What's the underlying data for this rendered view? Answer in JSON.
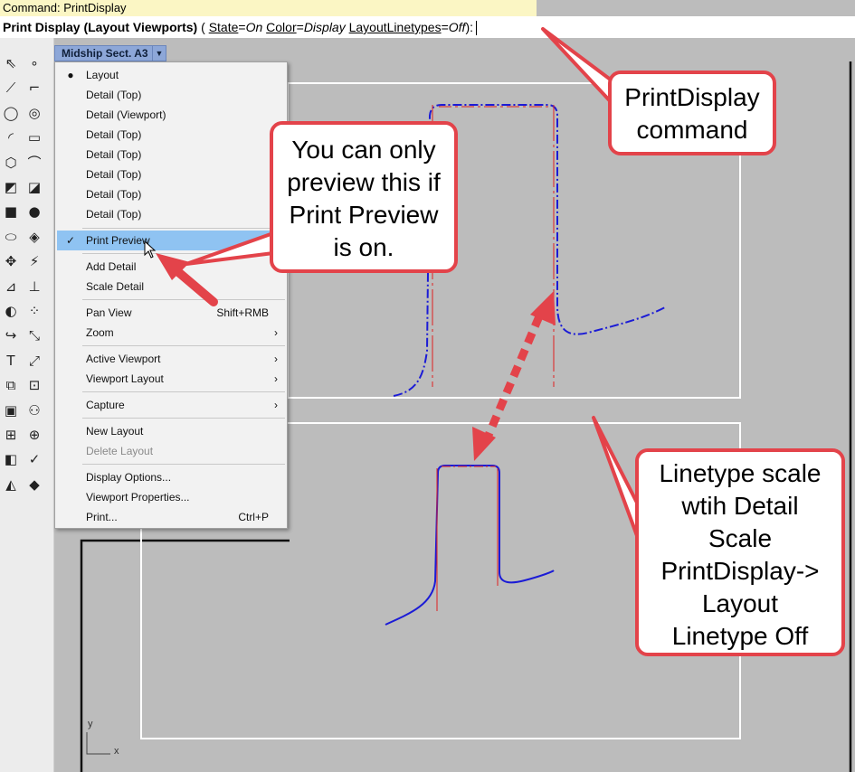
{
  "command_line": {
    "history": "Command: PrintDisplay",
    "prompt_command": "Print Display (Layout Viewports)",
    "options_open": "(",
    "options": [
      {
        "name": "State",
        "value": "On"
      },
      {
        "name": "Color",
        "value": "Display"
      },
      {
        "name": "LayoutLinetypes",
        "value": "Off"
      }
    ],
    "options_close": "):"
  },
  "layout_tab": {
    "label": "Midship Sect. A3",
    "arrow": "▼"
  },
  "context_menu": {
    "items": [
      {
        "label": "Layout",
        "mark": "●"
      },
      {
        "label": "Detail (Top)"
      },
      {
        "label": "Detail (Viewport)"
      },
      {
        "label": "Detail (Top)"
      },
      {
        "label": "Detail (Top)"
      },
      {
        "label": "Detail (Top)"
      },
      {
        "label": "Detail (Top)"
      },
      {
        "label": "Detail (Top)"
      },
      {
        "label": "Print Preview",
        "mark": "✓"
      },
      {
        "label": "Add Detail"
      },
      {
        "label": "Scale Detail"
      },
      {
        "label": "Pan View",
        "shortcut": "Shift+RMB"
      },
      {
        "label": "Zoom",
        "submenu": "›"
      },
      {
        "label": "Active Viewport",
        "submenu": "›"
      },
      {
        "label": "Viewport Layout",
        "submenu": "›"
      },
      {
        "label": "Capture",
        "submenu": "›"
      },
      {
        "label": "New Layout"
      },
      {
        "label": "Delete Layout"
      },
      {
        "label": "Display Options..."
      },
      {
        "label": "Viewport Properties..."
      },
      {
        "label": "Print...",
        "shortcut": "Ctrl+P"
      }
    ]
  },
  "axis": {
    "y": "y",
    "x": "x"
  },
  "callouts": {
    "print_preview_note": [
      "You can only",
      "preview this if",
      "Print Preview",
      "is on."
    ],
    "printdisplay_note": [
      "PrintDisplay",
      "command"
    ],
    "linetype_note": [
      "Linetype scale",
      "wtih Detail",
      "Scale",
      "PrintDisplay->",
      "Layout",
      "Linetype Off"
    ]
  },
  "colors": {
    "callout_border": "#e3434a",
    "menu_highlight": "#8fc3f2",
    "command_history_bg": "#fbf6c4",
    "curve_blue": "#1b1bd6",
    "curve_red": "#e02020",
    "viewport_bg": "#bcbcbc"
  },
  "icons": {
    "toolbar": [
      "pointer-icon",
      "point-icon",
      "polyline-icon",
      "curve-icon",
      "circle-icon",
      "circle-center-icon",
      "arc-icon",
      "rectangle-icon",
      "polygon-icon",
      "curve-edit-icon",
      "surface-icon",
      "surface-patch-icon",
      "box-icon",
      "sphere-icon",
      "cylinder-icon",
      "mesh-icon",
      "transform-icon",
      "boolean-icon",
      "trim-icon",
      "split-icon",
      "group-icon",
      "array-icon",
      "curve-offset-icon",
      "point-grid-icon",
      "text-icon",
      "dimension-icon",
      "block-icon",
      "detail-icon",
      "solid-tools-icon",
      "history-icon",
      "grid-snap-icon",
      "osnap-icon",
      "render-icon",
      "check-icon",
      "light-icon",
      "material-icon"
    ]
  }
}
